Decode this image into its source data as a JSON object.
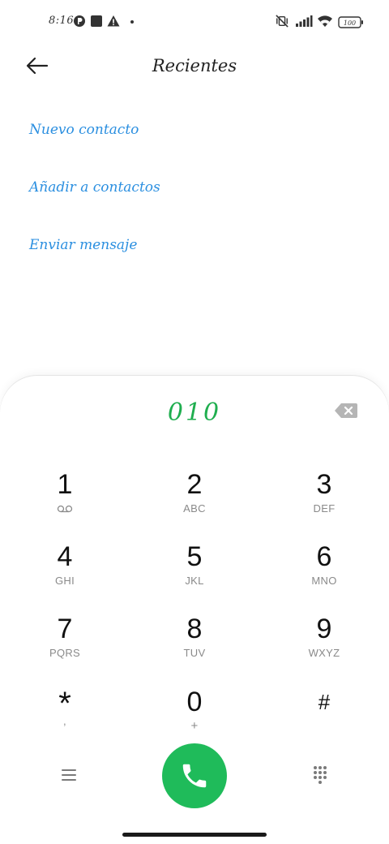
{
  "status_bar": {
    "time": "8:16",
    "battery": "100"
  },
  "header": {
    "title": "Recientes"
  },
  "actions": [
    {
      "label": "Nuevo contacto"
    },
    {
      "label": "Añadir a contactos"
    },
    {
      "label": "Enviar mensaje"
    }
  ],
  "dialpad": {
    "number": "010",
    "keys": [
      {
        "digit": "1",
        "letters": ""
      },
      {
        "digit": "2",
        "letters": "ABC"
      },
      {
        "digit": "3",
        "letters": "DEF"
      },
      {
        "digit": "4",
        "letters": "GHI"
      },
      {
        "digit": "5",
        "letters": "JKL"
      },
      {
        "digit": "6",
        "letters": "MNO"
      },
      {
        "digit": "7",
        "letters": "PQRS"
      },
      {
        "digit": "8",
        "letters": "TUV"
      },
      {
        "digit": "9",
        "letters": "WXYZ"
      },
      {
        "digit": "*",
        "letters": ","
      },
      {
        "digit": "0",
        "letters": "+"
      },
      {
        "digit": "#",
        "letters": ""
      }
    ]
  },
  "colors": {
    "accent_blue": "#2b8fe0",
    "number_green": "#1fae4f",
    "call_green": "#1fbb5a"
  }
}
